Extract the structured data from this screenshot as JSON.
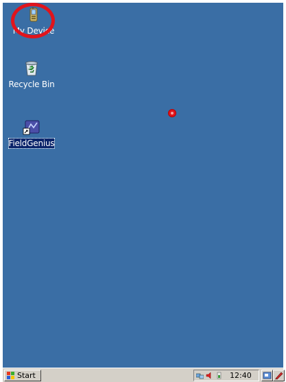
{
  "desktop": {
    "background_color": "#3a6ea5",
    "icons": [
      {
        "label": "My Device",
        "icon": "my-device-icon"
      },
      {
        "label": "Recycle Bin",
        "icon": "recycle-bin-icon"
      },
      {
        "label": "FieldGenius",
        "icon": "fieldgenius-shortcut-icon",
        "selected": true
      }
    ]
  },
  "taskbar": {
    "start_label": "Start",
    "clock": "12:40",
    "tray_icons": [
      "network-icon",
      "volume-icon",
      "battery-icon"
    ],
    "show_desktop_icon": "show-desktop-icon",
    "input_panel_icon": "pen-icon"
  },
  "annotations": {
    "highlight_color": "#e0141c"
  }
}
